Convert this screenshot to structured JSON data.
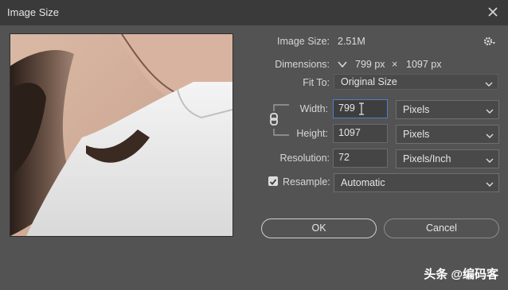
{
  "window": {
    "title": "Image Size"
  },
  "image_size": {
    "label": "Image Size:",
    "value": "2.51M"
  },
  "dimensions": {
    "label": "Dimensions:",
    "width": "799 px",
    "x": "×",
    "height": "1097 px"
  },
  "fit_to": {
    "label": "Fit To:",
    "value": "Original Size"
  },
  "width": {
    "label": "Width:",
    "value": "799",
    "unit": "Pixels"
  },
  "height": {
    "label": "Height:",
    "value": "1097",
    "unit": "Pixels"
  },
  "resolution": {
    "label": "Resolution:",
    "value": "72",
    "unit": "Pixels/Inch"
  },
  "resample": {
    "label": "Resample:",
    "value": "Automatic",
    "checked": true
  },
  "buttons": {
    "ok": "OK",
    "cancel": "Cancel"
  },
  "watermark": {
    "text": "头条 @编码客"
  },
  "icons": {
    "close": "close-icon",
    "gear": "gear-icon",
    "chain": "chain-link-icon",
    "chevron": "chevron-down-icon",
    "check": "checkbox-check-icon"
  }
}
